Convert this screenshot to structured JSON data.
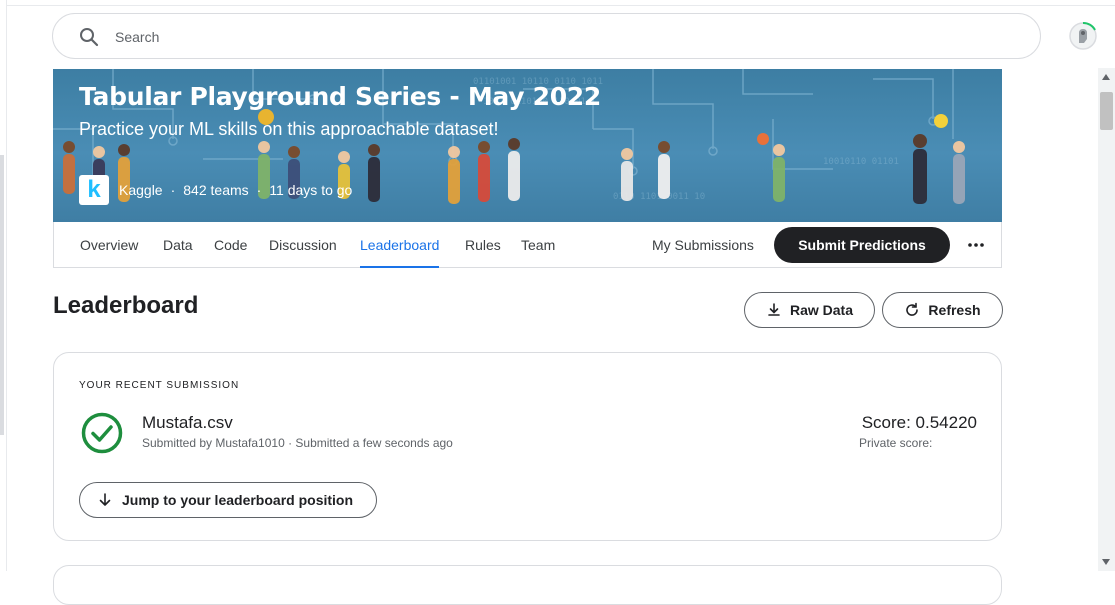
{
  "search": {
    "placeholder": "Search"
  },
  "competition": {
    "title": "Tabular Playground Series - May 2022",
    "subtitle": "Practice your ML skills on this approachable dataset!",
    "host": "Kaggle",
    "teams": "842 teams",
    "deadline": "11 days to go",
    "logo_letter": "k",
    "separator": "·"
  },
  "tabs": [
    "Overview",
    "Data",
    "Code",
    "Discussion",
    "Leaderboard",
    "Rules",
    "Team"
  ],
  "active_tab": "Leaderboard",
  "actions": {
    "my_submissions": "My Submissions",
    "submit": "Submit Predictions"
  },
  "leaderboard": {
    "title": "Leaderboard",
    "raw_data": "Raw Data",
    "refresh": "Refresh"
  },
  "recent_submission": {
    "heading": "YOUR RECENT SUBMISSION",
    "filename": "Mustafa.csv",
    "meta": "Submitted by Mustafa1010 · Submitted a few seconds ago",
    "score": "Score: 0.54220",
    "private_score": "Private score:",
    "jump_label": "Jump to your leaderboard position",
    "status_icon": "check-circle-icon"
  },
  "colors": {
    "accent": "#1a73e8",
    "success": "#1e8e3e",
    "primary_button": "#202124",
    "banner": "#4a8db5"
  }
}
